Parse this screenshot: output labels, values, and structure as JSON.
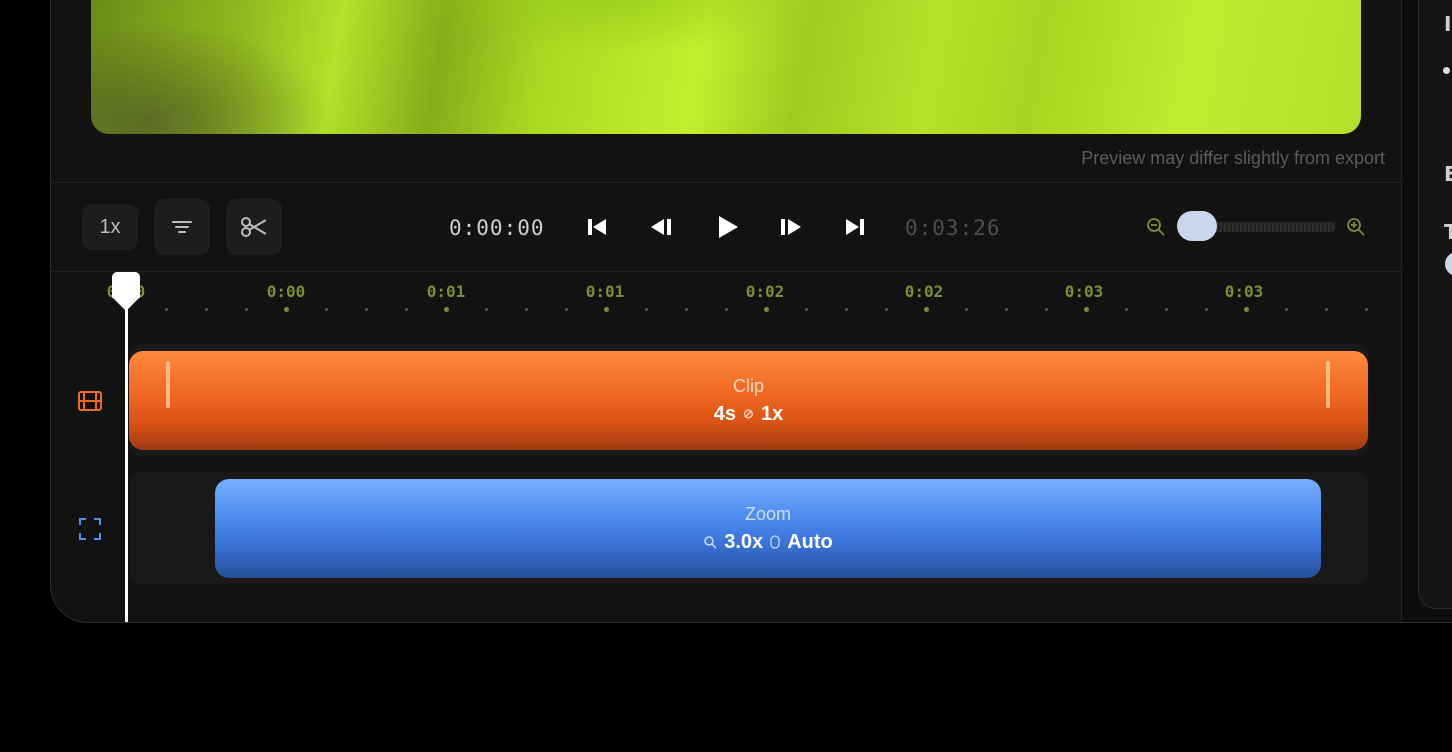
{
  "preview": {
    "note": "Preview may differ slightly from export"
  },
  "toolbar": {
    "speed_label": "1x",
    "current_time": "0:00:00",
    "total_time": "0:03:26",
    "zoom_level": 0.1,
    "icons": {
      "captions": "text-lines-icon",
      "cut": "scissors-icon",
      "skip_back": "skip-to-start-icon",
      "step_back": "step-back-icon",
      "play": "play-icon",
      "step_forward": "step-forward-icon",
      "skip_forward": "skip-to-end-icon",
      "zoom_out": "zoom-out-icon",
      "zoom_in": "zoom-in-icon"
    }
  },
  "ruler": {
    "labels": [
      "0:00",
      "0:00",
      "0:01",
      "0:01",
      "0:02",
      "0:02",
      "0:03",
      "0:03"
    ]
  },
  "tracks": {
    "clip": {
      "icon": "film-icon",
      "title": "Clip",
      "duration": "4s",
      "speed": "1x",
      "color": "#f06a24"
    },
    "zoom": {
      "icon": "focus-frame-icon",
      "title": "Zoom",
      "scale": "3.0x",
      "mode": "Auto",
      "color": "#4f8ff0"
    }
  },
  "side_panel": {
    "letters": [
      "I",
      "E",
      "T"
    ]
  },
  "colors": {
    "accent_green": "#7b8f33",
    "playhead": "#ffffff"
  }
}
